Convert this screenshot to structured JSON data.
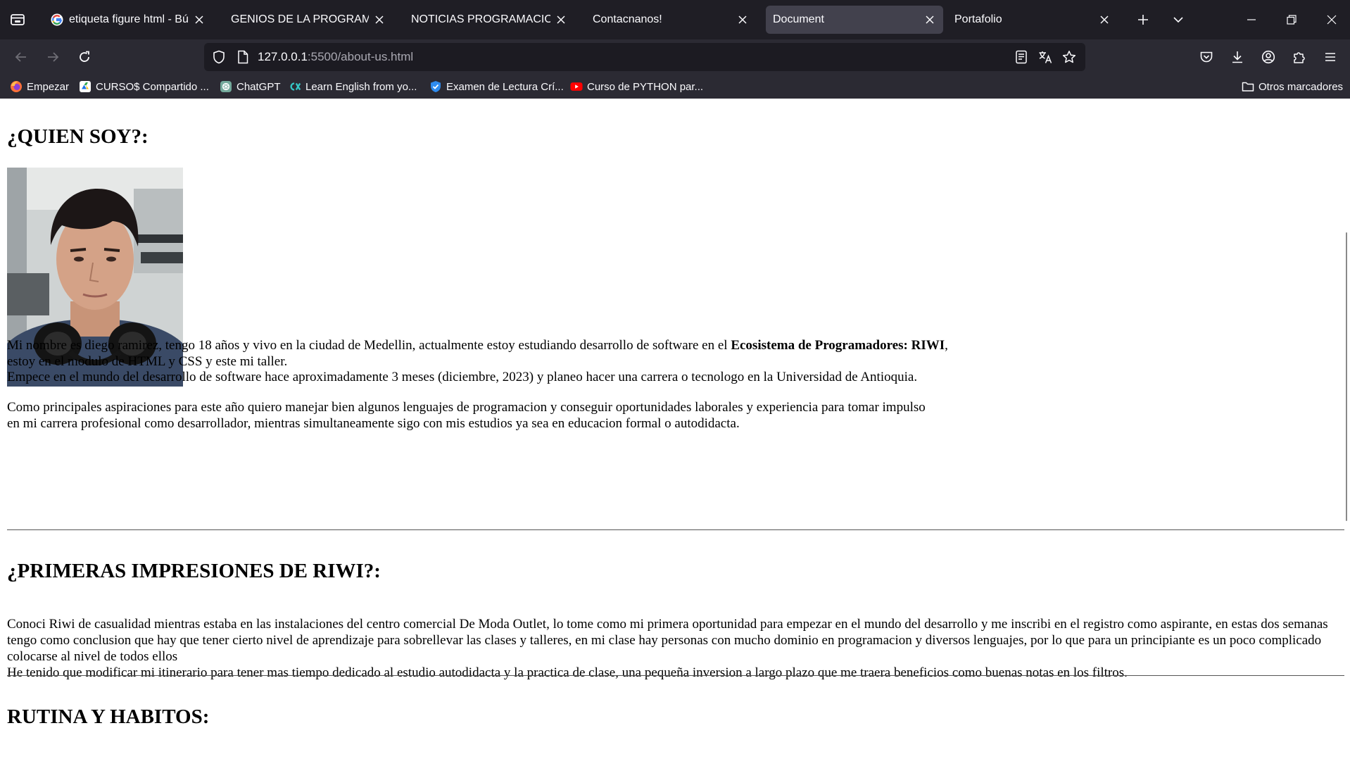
{
  "browser": {
    "tabs": [
      {
        "title": "etiqueta figure html - Búsqueda de Google",
        "favicon": "google-icon",
        "active": false
      },
      {
        "title": "GENIOS DE LA PROGRAMACION",
        "favicon": "",
        "active": false
      },
      {
        "title": "NOTICIAS PROGRAMACION",
        "favicon": "",
        "active": false
      },
      {
        "title": "Contacnanos!",
        "favicon": "",
        "active": false
      },
      {
        "title": "Document",
        "favicon": "",
        "active": true
      },
      {
        "title": "Portafolio",
        "favicon": "",
        "active": false
      }
    ],
    "url": {
      "host": "127.0.0.1",
      "rest": ":5500/about-us.html"
    },
    "bookmarks": [
      {
        "label": "Empezar",
        "icon": "firefox-icon"
      },
      {
        "label": "CURSO$ Compartido ...",
        "icon": "drive-icon"
      },
      {
        "label": "ChatGPT",
        "icon": "chatgpt-icon"
      },
      {
        "label": "Learn English from yo...",
        "icon": "learn-english-icon"
      },
      {
        "label": "Examen de Lectura Crí...",
        "icon": "shield-check-icon"
      },
      {
        "label": "Curso de PYTHON par...",
        "icon": "youtube-icon"
      }
    ],
    "other_bookmarks": "Otros marcadores"
  },
  "page": {
    "section1": {
      "heading": "¿QUIEN SOY?:",
      "photo_alt": "foto de perfil",
      "p1_before": "Mi nombre es diego ramirez, tengo 18 años y vivo en la ciudad de Medellin, actualmente estoy estudiando desarrollo de software en el ",
      "p1_bold": "Ecosistema de Programadores: RIWI",
      "p1_comma": ",",
      "p1_after": "estoy en el modulo de HTML y CSS y este mi taller.",
      "p2": "Empece en el mundo del desarrollo de software hace aproximadamente 3 meses (diciembre, 2023) y planeo hacer una carrera o tecnologo en la Universidad de Antioquia.",
      "p3_line1": "Como principales aspiraciones para este año quiero manejar bien algunos lenguajes de programacion y conseguir oportunidades laborales y experiencia para tomar impulso",
      "p3_line2": "en mi carrera profesional como desarrollador, mientras simultaneamente sigo con mis estudios ya sea en educacion formal o autodidacta."
    },
    "section2": {
      "heading": "¿PRIMERAS IMPRESIONES DE RIWI?:",
      "p1": "Conoci Riwi de casualidad mientras estaba en las instalaciones del centro comercial De Moda Outlet, lo tome como mi primera oportunidad para empezar en el mundo del desarrollo y me inscribi en el registro como aspirante, en estas dos semanas tengo como conclusion que hay que tener cierto nivel de aprendizaje para sobrellevar las clases y talleres, en mi clase hay personas con mucho dominio en programacion y diversos lenguajes, por lo que para un principiante es un poco complicado colocarse al nivel de todos ellos",
      "p2": "He tenido que modificar mi itinerario para tener mas tiempo dedicado al estudio autodidacta y la practica de clase, una pequeña inversion a largo plazo que me traera beneficios como buenas notas en los filtros."
    },
    "section3": {
      "heading": "RUTINA Y HABITOS:"
    }
  }
}
